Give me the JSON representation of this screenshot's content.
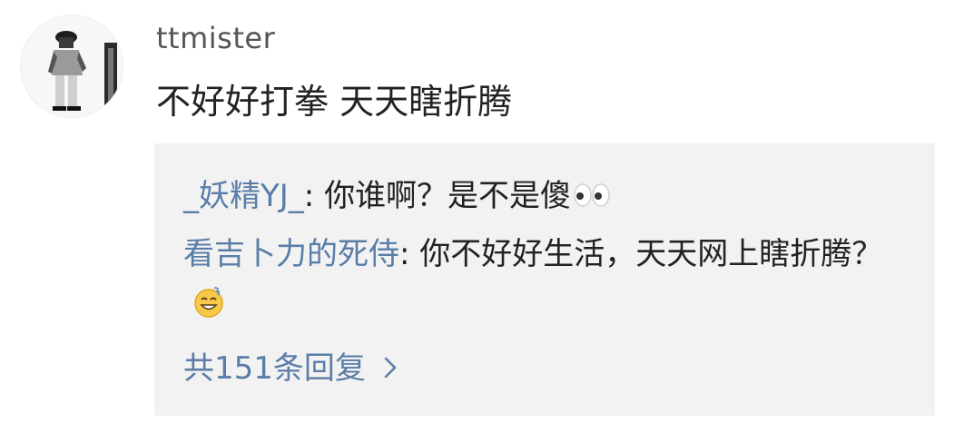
{
  "comment": {
    "username": "ttmister",
    "text": "不好好打拳 天天瞎折腾",
    "avatar_icon": "user-photo-avatar"
  },
  "replies": [
    {
      "author": "_妖精YJ_",
      "separator": ": ",
      "text": "你谁啊？是不是傻",
      "emoji": "eyes-icon"
    },
    {
      "author": "看吉卜力的死侍",
      "separator": ": ",
      "text": "你不好好生活，天天网上瞎折腾？",
      "emoji": "grin-sweat-icon"
    }
  ],
  "more_replies": {
    "label": "共151条回复",
    "icon": "chevron-right-icon"
  },
  "colors": {
    "link_blue": "#5a7da8",
    "reply_background": "#f2f2f2",
    "username_gray": "#555555",
    "text_dark": "#222222"
  }
}
